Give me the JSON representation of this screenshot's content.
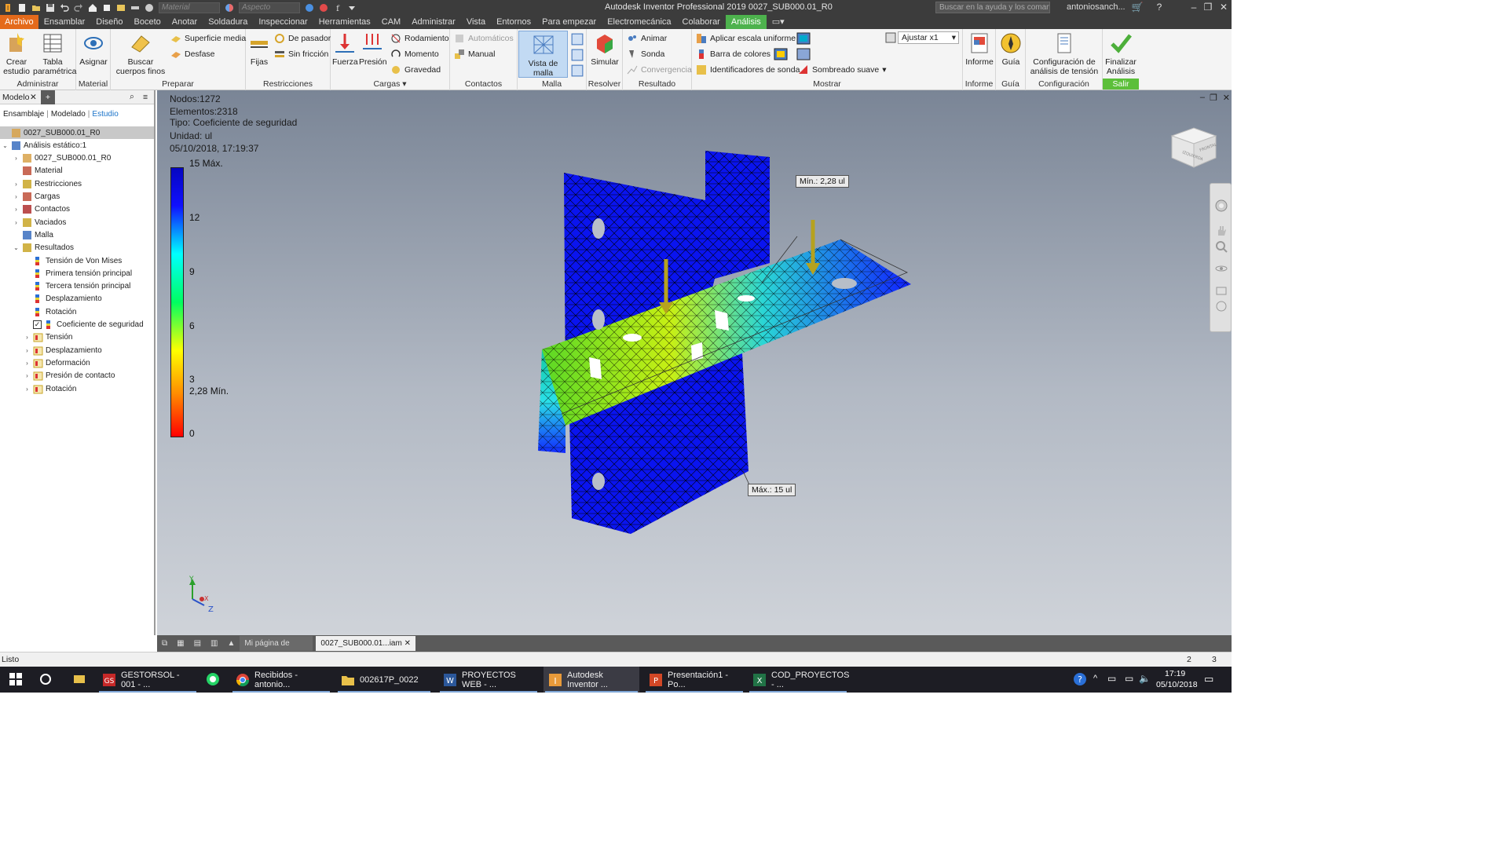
{
  "window": {
    "title": "Autodesk Inventor Professional 2019   0027_SUB000.01_R0",
    "material_placeholder": "Material",
    "appearance_placeholder": "Aspecto",
    "help_search_placeholder": "Buscar en la ayuda y los comandos",
    "user": "antoniosanch..."
  },
  "menu_tabs": [
    "Archivo",
    "Ensamblar",
    "Diseño",
    "Boceto",
    "Anotar",
    "Soldadura",
    "Inspeccionar",
    "Herramientas",
    "CAM",
    "Administrar",
    "Vista",
    "Entornos",
    "Para empezar",
    "Electromecánica",
    "Colaborar",
    "Análisis"
  ],
  "ribbon": {
    "administrar": {
      "crear_estudio": "Crear estudio",
      "tabla_parametrica": "Tabla paramétrica",
      "label": "Administrar"
    },
    "material": {
      "asignar": "Asignar",
      "label": "Material"
    },
    "preparar": {
      "buscar": "Buscar cuerpos finos",
      "superficie": "Superficie media",
      "desfase": "Desfase",
      "label": "Preparar"
    },
    "restricciones": {
      "fijas": "Fijas",
      "pasador": "De pasador",
      "sin_friccion": "Sin fricción",
      "label": "Restricciones"
    },
    "cargas": {
      "fuerza": "Fuerza",
      "presion": "Presión",
      "rodamiento": "Rodamiento",
      "momento": "Momento",
      "gravedad": "Gravedad",
      "label": "Cargas"
    },
    "contactos": {
      "automaticos": "Automáticos",
      "manual": "Manual",
      "label": "Contactos"
    },
    "malla": {
      "vista": "Vista de malla",
      "label": "Malla"
    },
    "resolver": {
      "simular": "Simular",
      "label": "Resolver"
    },
    "resultado": {
      "animar": "Animar",
      "sonda": "Sonda",
      "convergencia": "Convergencia",
      "label": "Resultado"
    },
    "mostrar": {
      "escala": "Aplicar escala uniforme",
      "barra": "Barra de colores",
      "identificadores": "Identificadores de sonda",
      "sombreado": "Sombreado suave",
      "ajustar": "Ajustar x1",
      "label": "Mostrar"
    },
    "informe": {
      "informe": "Informe",
      "label": "Informe"
    },
    "guia": {
      "guia": "Guía",
      "label": "Guía"
    },
    "configuracion": {
      "config": "Configuración de análisis de tensión",
      "label": "Configuración"
    },
    "salir": {
      "finalizar": "Finalizar Análisis",
      "label": "Salir"
    }
  },
  "browser": {
    "tab": "Modelo",
    "subtabs": [
      "Ensamblaje",
      "Modelado",
      "Estudio"
    ],
    "tree": [
      {
        "label": "0027_SUB000.01_R0",
        "level": 0,
        "exp": "",
        "icon": "assembly-icon"
      },
      {
        "label": "Análisis estático:1",
        "level": 0,
        "exp": "v",
        "icon": "analysis-icon"
      },
      {
        "label": "0027_SUB000.01_R0",
        "level": 1,
        "exp": ">",
        "icon": "assembly-icon"
      },
      {
        "label": "Material",
        "level": 1,
        "exp": "",
        "icon": "material-icon"
      },
      {
        "label": "Restricciones",
        "level": 1,
        "exp": ">",
        "icon": "constraint-icon"
      },
      {
        "label": "Cargas",
        "level": 1,
        "exp": ">",
        "icon": "load-icon"
      },
      {
        "label": "Contactos",
        "level": 1,
        "exp": ">",
        "icon": "contact-icon"
      },
      {
        "label": "Vaciados",
        "level": 1,
        "exp": ">",
        "icon": "shell-icon"
      },
      {
        "label": "Malla",
        "level": 1,
        "exp": "",
        "icon": "mesh-icon"
      },
      {
        "label": "Resultados",
        "level": 1,
        "exp": "v",
        "icon": "results-icon"
      },
      {
        "label": "Tensión de Von Mises",
        "level": 2,
        "exp": "",
        "icon": "result-icon"
      },
      {
        "label": "Primera tensión principal",
        "level": 2,
        "exp": "",
        "icon": "result-icon"
      },
      {
        "label": "Tercera tensión principal",
        "level": 2,
        "exp": "",
        "icon": "result-icon"
      },
      {
        "label": "Desplazamiento",
        "level": 2,
        "exp": "",
        "icon": "result-icon"
      },
      {
        "label": "Rotación",
        "level": 2,
        "exp": "",
        "icon": "result-icon"
      },
      {
        "label": "Coeficiente de seguridad",
        "level": 2,
        "exp": "",
        "icon": "result-icon",
        "checked": true
      },
      {
        "label": "Tensión",
        "level": 2,
        "exp": ">",
        "icon": "folder-icon"
      },
      {
        "label": "Desplazamiento",
        "level": 2,
        "exp": ">",
        "icon": "folder-icon"
      },
      {
        "label": "Deformación",
        "level": 2,
        "exp": ">",
        "icon": "folder-icon"
      },
      {
        "label": "Presión de contacto",
        "level": 2,
        "exp": ">",
        "icon": "folder-icon"
      },
      {
        "label": "Rotación",
        "level": 2,
        "exp": ">",
        "icon": "folder-icon"
      }
    ]
  },
  "viewport": {
    "info": {
      "nodos": "Nodos:1272",
      "elementos": "Elementos:2318",
      "tipo": "Tipo: Coeficiente de seguridad",
      "unidad": "Unidad: ul",
      "fecha": "05/10/2018, 17:19:37"
    },
    "legend": {
      "max": "15 Máx.",
      "t12": "12",
      "t9": "9",
      "t6": "6",
      "t3": "3",
      "min": "2,28 Mín.",
      "t0": "0"
    },
    "callout_min": "Mín.: 2,28 ul",
    "callout_max": "Máx.: 15 ul",
    "viewcube": {
      "left": "IZQUIERDA",
      "front": "FRONTAL"
    },
    "axes": {
      "x": "X",
      "y": "Y",
      "z": "Z"
    }
  },
  "doc_tabs": [
    "Mi página de inic...",
    "0027_SUB000.01...iam"
  ],
  "status": {
    "text": "Listo",
    "n1": "2",
    "n2": "3"
  },
  "taskbar": {
    "items": [
      "GESTORSOL - 001 - ...",
      "Recibidos - antonio...",
      "002617P_0022",
      "PROYECTOS WEB - ...",
      "Autodesk Inventor ...",
      "Presentación1 - Po...",
      "COD_PROYECTOS - ..."
    ],
    "time": "17:19",
    "date": "05/10/2018"
  }
}
